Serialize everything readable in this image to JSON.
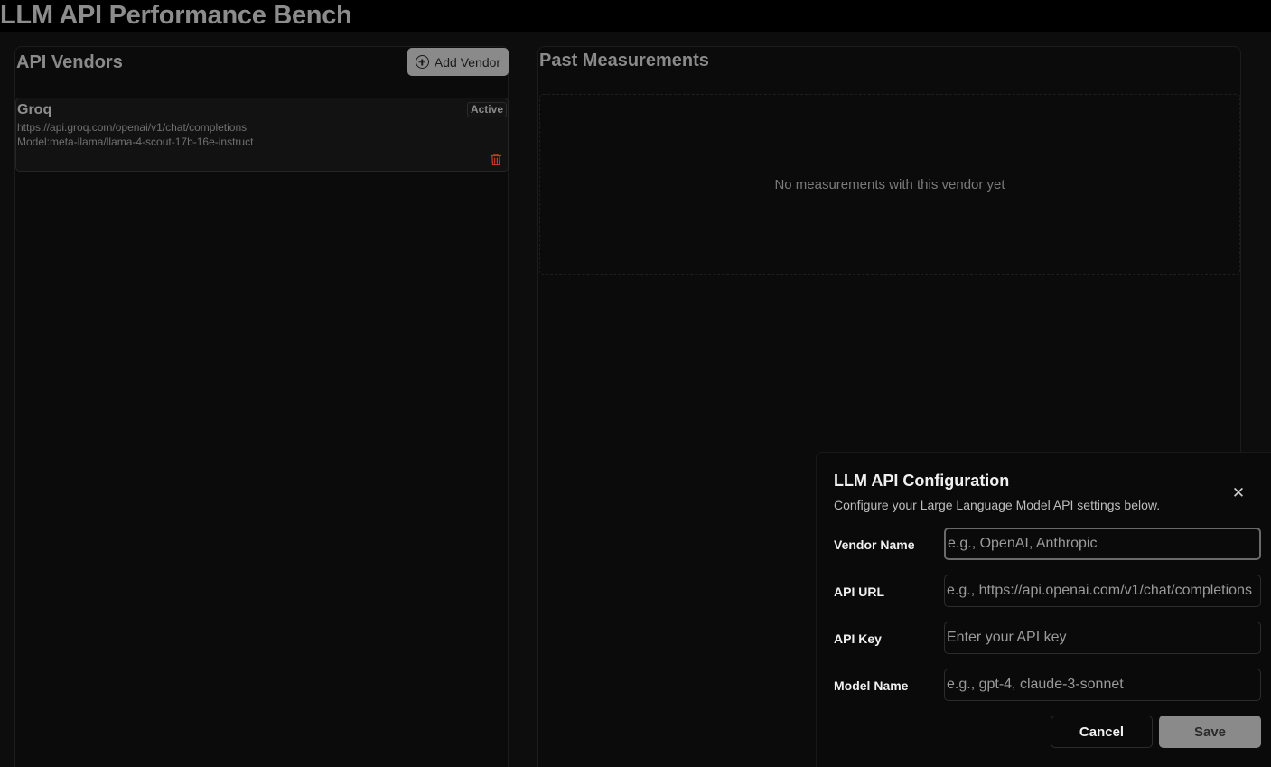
{
  "app": {
    "title": "LLM API Performance Bench"
  },
  "vendors_panel": {
    "title": "API Vendors",
    "add_vendor_label": "Add Vendor",
    "vendors": [
      {
        "name": "Groq",
        "url": "https://api.groq.com/openai/v1/chat/completions",
        "model": "Model:meta-llama/llama-4-scout-17b-16e-instruct",
        "status": "Active"
      }
    ]
  },
  "measurements_panel": {
    "title": "Past Measurements",
    "empty_text": "No measurements with this vendor yet"
  },
  "dialog": {
    "title": "LLM API Configuration",
    "description": "Configure your Large Language Model API settings below.",
    "fields": {
      "vendor_name": {
        "label": "Vendor Name",
        "placeholder": "e.g., OpenAI, Anthropic",
        "value": ""
      },
      "api_url": {
        "label": "API URL",
        "placeholder": "e.g., https://api.openai.com/v1/chat/completions",
        "value": ""
      },
      "api_key": {
        "label": "API Key",
        "placeholder": "Enter your API key",
        "value": ""
      },
      "model_name": {
        "label": "Model Name",
        "placeholder": "e.g., gpt-4, claude-3-sonnet",
        "value": ""
      }
    },
    "cancel_label": "Cancel",
    "save_label": "Save"
  },
  "icons": {
    "add": "plus-circle-icon",
    "delete": "trash-icon",
    "close": "close-icon"
  },
  "colors": {
    "background": "#0d0d0d",
    "accent_button": "#8a8a8a",
    "delete_icon": "#c0392b"
  }
}
